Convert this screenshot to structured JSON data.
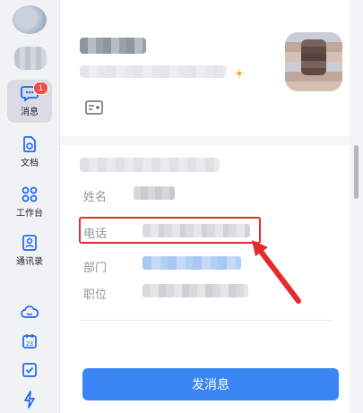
{
  "sidebar": {
    "items": [
      {
        "label": "消息",
        "icon": "chat-icon",
        "badge": "1",
        "active": true
      },
      {
        "label": "文档",
        "icon": "document-icon"
      },
      {
        "label": "工作台",
        "icon": "apps-grid-icon"
      },
      {
        "label": "通讯录",
        "icon": "contacts-icon"
      }
    ],
    "bottom_icons": [
      "cloud-icon",
      "calendar-icon",
      "task-check-icon",
      "lightning-icon"
    ],
    "calendar_day": "23"
  },
  "profile": {
    "fields": [
      {
        "label": "姓名"
      },
      {
        "label": "电话"
      },
      {
        "label": "部门"
      },
      {
        "label": "职位"
      }
    ],
    "send_button": "发消息"
  },
  "colors": {
    "accent": "#3a86f4",
    "highlight": "#e32b2b",
    "badge": "#f54a45"
  }
}
